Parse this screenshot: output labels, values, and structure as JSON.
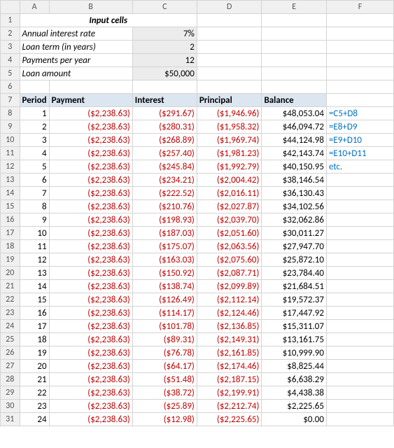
{
  "columns": [
    "A",
    "B",
    "C",
    "D",
    "E",
    "F"
  ],
  "rows": [
    "1",
    "2",
    "3",
    "4",
    "5",
    "6",
    "7",
    "8",
    "9",
    "10",
    "11",
    "12",
    "13",
    "14",
    "15",
    "16",
    "17",
    "18",
    "19",
    "20",
    "21",
    "22",
    "23",
    "24",
    "25",
    "26",
    "27",
    "28",
    "29",
    "30",
    "31"
  ],
  "input": {
    "title": "Input cells",
    "rate_label": "Annual interest rate",
    "rate_value": "7%",
    "term_label": "Loan term (in years)",
    "term_value": "2",
    "ppy_label": "Payments per year",
    "ppy_value": "12",
    "amount_label": "Loan amount",
    "amount_value": "$50,000"
  },
  "headers": {
    "period": "Period",
    "payment": "Payment",
    "interest": "Interest",
    "principal": "Principal",
    "balance": "Balance"
  },
  "formulas": {
    "r8": "=C5+D8",
    "r9": "=E8+D9",
    "r10": "=E9+D10",
    "r11": "=E10+D11",
    "r12": "etc."
  },
  "amort": [
    {
      "p": "1",
      "pay": "($2,238.63)",
      "int": "($291.67)",
      "prin": "($1,946.96)",
      "bal": "$48,053.04"
    },
    {
      "p": "2",
      "pay": "($2,238.63)",
      "int": "($280.31)",
      "prin": "($1,958.32)",
      "bal": "$46,094.72"
    },
    {
      "p": "3",
      "pay": "($2,238.63)",
      "int": "($268.89)",
      "prin": "($1,969.74)",
      "bal": "$44,124.98"
    },
    {
      "p": "4",
      "pay": "($2,238.63)",
      "int": "($257.40)",
      "prin": "($1,981.23)",
      "bal": "$42,143.74"
    },
    {
      "p": "5",
      "pay": "($2,238.63)",
      "int": "($245.84)",
      "prin": "($1,992.79)",
      "bal": "$40,150.95"
    },
    {
      "p": "6",
      "pay": "($2,238.63)",
      "int": "($234.21)",
      "prin": "($2,004.42)",
      "bal": "$38,146.54"
    },
    {
      "p": "7",
      "pay": "($2,238.63)",
      "int": "($222.52)",
      "prin": "($2,016.11)",
      "bal": "$36,130.43"
    },
    {
      "p": "8",
      "pay": "($2,238.63)",
      "int": "($210.76)",
      "prin": "($2,027.87)",
      "bal": "$34,102.56"
    },
    {
      "p": "9",
      "pay": "($2,238.63)",
      "int": "($198.93)",
      "prin": "($2,039.70)",
      "bal": "$32,062.86"
    },
    {
      "p": "10",
      "pay": "($2,238.63)",
      "int": "($187.03)",
      "prin": "($2,051.60)",
      "bal": "$30,011.27"
    },
    {
      "p": "11",
      "pay": "($2,238.63)",
      "int": "($175.07)",
      "prin": "($2,063.56)",
      "bal": "$27,947.70"
    },
    {
      "p": "12",
      "pay": "($2,238.63)",
      "int": "($163.03)",
      "prin": "($2,075.60)",
      "bal": "$25,872.10"
    },
    {
      "p": "13",
      "pay": "($2,238.63)",
      "int": "($150.92)",
      "prin": "($2,087.71)",
      "bal": "$23,784.40"
    },
    {
      "p": "14",
      "pay": "($2,238.63)",
      "int": "($138.74)",
      "prin": "($2,099.89)",
      "bal": "$21,684.51"
    },
    {
      "p": "15",
      "pay": "($2,238.63)",
      "int": "($126.49)",
      "prin": "($2,112.14)",
      "bal": "$19,572.37"
    },
    {
      "p": "16",
      "pay": "($2,238.63)",
      "int": "($114.17)",
      "prin": "($2,124.46)",
      "bal": "$17,447.92"
    },
    {
      "p": "17",
      "pay": "($2,238.63)",
      "int": "($101.78)",
      "prin": "($2,136.85)",
      "bal": "$15,311.07"
    },
    {
      "p": "18",
      "pay": "($2,238.63)",
      "int": "($89.31)",
      "prin": "($2,149.31)",
      "bal": "$13,161.75"
    },
    {
      "p": "19",
      "pay": "($2,238.63)",
      "int": "($76.78)",
      "prin": "($2,161.85)",
      "bal": "$10,999.90"
    },
    {
      "p": "20",
      "pay": "($2,238.63)",
      "int": "($64.17)",
      "prin": "($2,174.46)",
      "bal": "$8,825.44"
    },
    {
      "p": "21",
      "pay": "($2,238.63)",
      "int": "($51.48)",
      "prin": "($2,187.15)",
      "bal": "$6,638.29"
    },
    {
      "p": "22",
      "pay": "($2,238.63)",
      "int": "($38.72)",
      "prin": "($2,199.91)",
      "bal": "$4,438.38"
    },
    {
      "p": "23",
      "pay": "($2,238.63)",
      "int": "($25.89)",
      "prin": "($2,212.74)",
      "bal": "$2,225.65"
    },
    {
      "p": "24",
      "pay": "($2,238.63)",
      "int": "($12.98)",
      "prin": "($2,225.65)",
      "bal": "$0.00"
    }
  ]
}
